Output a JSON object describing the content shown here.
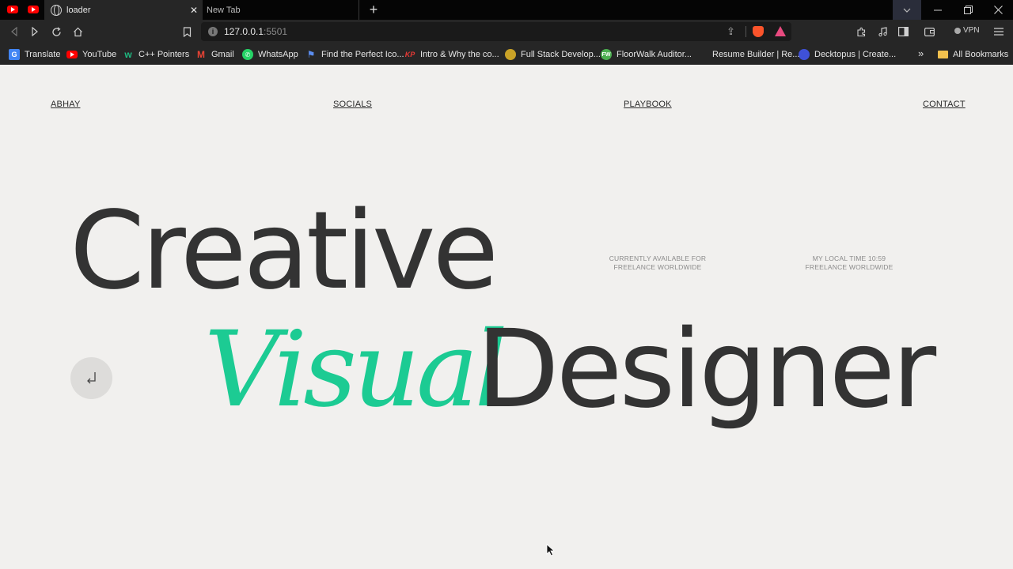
{
  "browser": {
    "tabs": [
      {
        "title": "loader",
        "active": true
      },
      {
        "title": "New Tab",
        "active": false
      }
    ],
    "address": {
      "host": "127.0.0.1",
      "port": ":5501"
    },
    "vpn_label": "VPN",
    "bookmarks": [
      {
        "label": "Translate",
        "icon": "google-translate-icon"
      },
      {
        "label": "YouTube",
        "icon": "youtube-icon"
      },
      {
        "label": "C++ Pointers",
        "icon": "w-icon"
      },
      {
        "label": "Gmail",
        "icon": "gmail-icon"
      },
      {
        "label": "WhatsApp",
        "icon": "whatsapp-icon"
      },
      {
        "label": "Find the Perfect Ico...",
        "icon": "flag-icon"
      },
      {
        "label": "Intro & Why the co...",
        "icon": "kp-icon"
      },
      {
        "label": "Full Stack Develop...",
        "icon": "fullstack-icon"
      },
      {
        "label": "FloorWalk Auditor...",
        "icon": "fw-icon"
      },
      {
        "label": "Resume Builder | Re...",
        "icon": "none"
      },
      {
        "label": "Decktopus | Create...",
        "icon": "decktopus-icon"
      }
    ],
    "all_bookmarks_label": "All Bookmarks"
  },
  "page": {
    "nav": {
      "brand": "ABHAY",
      "socials": "SOCIALS",
      "playbook": "PLAYBOOK",
      "contact": "CONTACT"
    },
    "hero": {
      "line1": "Creative",
      "accent": "Visual",
      "line2_rest": "Designer"
    },
    "availability": {
      "line1": "CURRENTLY AVAILABLE FOR",
      "line2": "FREELANCE WORLDWIDE"
    },
    "local_time": {
      "line1": "MY LOCAL TIME 10:59",
      "line2": "FREELANCE WORLDWIDE"
    },
    "colors": {
      "accent": "#1ccb93",
      "text": "#333333",
      "background": "#f1f0ee"
    }
  }
}
